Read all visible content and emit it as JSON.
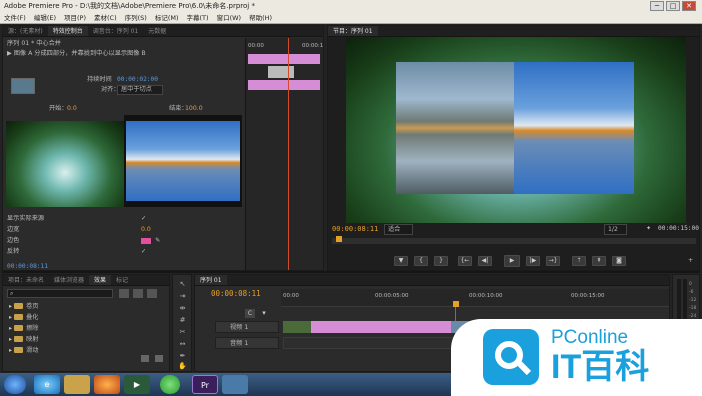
{
  "window": {
    "title": "Adobe Premiere Pro - D:\\我的文档\\Adobe\\Premiere Pro\\6.0\\未命名.prproj *",
    "min": "─",
    "max": "□",
    "close": "✕"
  },
  "menu": [
    "文件(F)",
    "编辑(E)",
    "项目(P)",
    "素材(C)",
    "序列(S)",
    "标记(M)",
    "字幕(T)",
    "窗口(W)",
    "帮助(H)"
  ],
  "effect_controls": {
    "tabs": [
      "源：(无素材)",
      "特效控制台",
      "调音台：序列 01",
      "元数据"
    ],
    "seq_name": "序列 01 * 中心合并",
    "description": "▶ 图像 A 分成四部分，并靠拢到中心以显示图像 B",
    "duration_label": "持续时间",
    "duration_value": "00:00:02:00",
    "align_label": "对齐：",
    "align_value": "居中于切点",
    "start_label": "开始：",
    "start_value": "0.0",
    "end_label": "结束：",
    "end_value": "100.0",
    "show_actual": "显示实际来源",
    "border_width": "边宽",
    "border_width_value": "0.0",
    "border_color": "边色",
    "border_color_value": "#e44fa0",
    "reverse": "反转",
    "mini_time": "00:00",
    "mini_time2": "00:00:1",
    "timecode": "00:00:08:11"
  },
  "program_monitor": {
    "tab": "节目：序列 01",
    "timecode": "00:00:08:11",
    "fit": "适合",
    "page": "1/2",
    "duration": "00:00:15:00"
  },
  "project_panel": {
    "tabs": [
      "项目：未命名",
      "媒体浏览器",
      "效果",
      "标记"
    ],
    "items": [
      "卷页",
      "叠化",
      "擦除",
      "映射",
      "滑动"
    ]
  },
  "timeline": {
    "tab": "序列 01",
    "timecode": "00:00:08:11",
    "ruler": [
      "00:00",
      "00:00:05:00",
      "00:00:10:00",
      "00:00:15:00"
    ],
    "track_v": "视频 1",
    "track_a": "音频 1",
    "audio_values": [
      "0",
      "-6",
      "-12",
      "-18",
      "-24",
      "-30",
      "-36",
      "-42",
      "-48",
      "-54",
      "dB"
    ]
  },
  "watermark": {
    "brand": "PConline",
    "cn": "IT百科",
    "accent": "#1aa0dc"
  },
  "taskbar": [
    "start",
    "ie",
    "explorer",
    "firefox",
    "media",
    "green",
    "premiere",
    "app"
  ]
}
